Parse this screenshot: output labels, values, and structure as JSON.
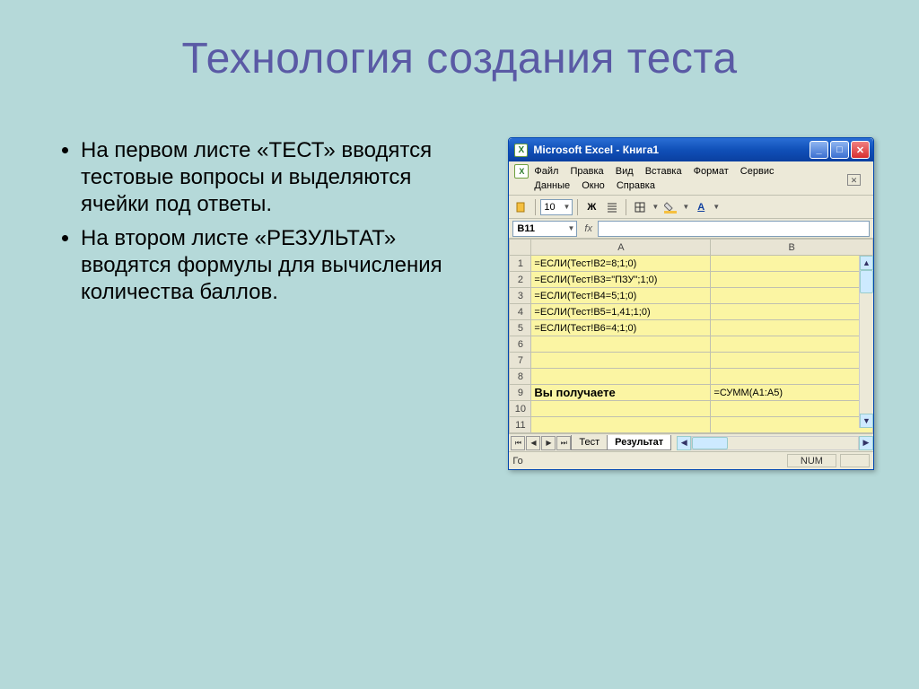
{
  "slide": {
    "title": "Технология создания теста",
    "bullets": [
      "На первом листе «ТЕСТ» вводятся тестовые вопросы и выделяются ячейки под ответы.",
      "На втором листе «РЕЗУЛЬТАТ» вводятся формулы для вычисления количества баллов."
    ]
  },
  "excel": {
    "title": "Microsoft Excel - Книга1",
    "menu": [
      "Файл",
      "Правка",
      "Вид",
      "Вставка",
      "Формат",
      "Сервис",
      "Данные",
      "Окно",
      "Справка"
    ],
    "fontsize": "10",
    "namebox": "B11",
    "columns": [
      "A",
      "B"
    ],
    "rows": [
      {
        "n": "1",
        "A": "=ЕСЛИ(Тест!B2=8;1;0)",
        "B": ""
      },
      {
        "n": "2",
        "A": "=ЕСЛИ(Тест!B3=\"ПЗУ\";1;0)",
        "B": ""
      },
      {
        "n": "3",
        "A": "=ЕСЛИ(Тест!B4=5;1;0)",
        "B": ""
      },
      {
        "n": "4",
        "A": "=ЕСЛИ(Тест!B5=1,41;1;0)",
        "B": ""
      },
      {
        "n": "5",
        "A": "=ЕСЛИ(Тест!B6=4;1;0)",
        "B": ""
      },
      {
        "n": "6",
        "A": "",
        "B": ""
      },
      {
        "n": "7",
        "A": "",
        "B": ""
      },
      {
        "n": "8",
        "A": "",
        "B": ""
      },
      {
        "n": "9",
        "A": "Вы получаете",
        "B": "=СУММ(A1:A5)",
        "bold": true
      },
      {
        "n": "10",
        "A": "",
        "B": ""
      },
      {
        "n": "11",
        "A": "",
        "B": ""
      }
    ],
    "tabs": [
      "Тест",
      "Результат"
    ],
    "active_tab": 1,
    "status_left": "Го",
    "status_num": "NUM"
  }
}
